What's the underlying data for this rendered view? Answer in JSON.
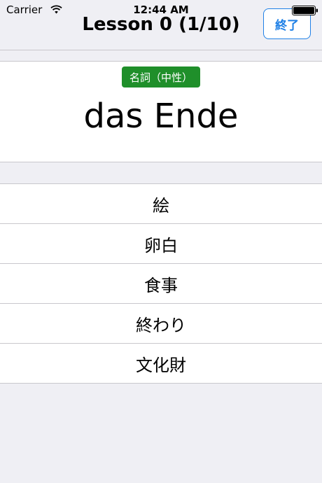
{
  "status_bar": {
    "carrier": "Carrier",
    "time": "12:44 AM",
    "wifi_icon": "wifi-icon",
    "battery_icon": "battery-icon"
  },
  "nav": {
    "title": "Lesson 0 (1/10)",
    "finish_label": "終了"
  },
  "card": {
    "part_of_speech": "名詞（中性）",
    "word": "das Ende"
  },
  "choices": [
    "絵",
    "卵白",
    "食事",
    "終わり",
    "文化財"
  ],
  "colors": {
    "accent": "#1f80e6",
    "badge": "#1f8f2a",
    "background": "#efeff4"
  }
}
